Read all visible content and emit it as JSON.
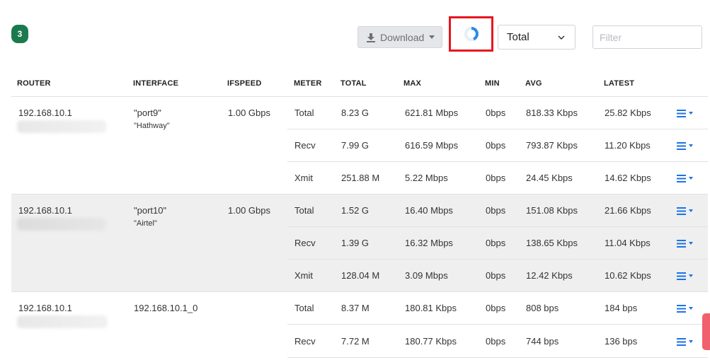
{
  "toolbar": {
    "count": "3",
    "download_label": "Download",
    "meter_select": "Total",
    "filter_placeholder": "Filter"
  },
  "colors": {
    "badge": "#1a7a4e",
    "highlight": "#e8141c",
    "accent": "#1a73e8"
  },
  "headers": [
    "ROUTER",
    "INTERFACE",
    "IFSPEED",
    "METER",
    "TOTAL",
    "MAX",
    "MIN",
    "AVG",
    "LATEST"
  ],
  "groups": [
    {
      "router": "192.168.10.1",
      "interface": "\"port9\"",
      "description": "\"Hathway\"",
      "ifspeed": "1.00 Gbps",
      "rows": [
        {
          "meter": "Total",
          "total": "8.23 G",
          "max": "621.81 Mbps",
          "min": "0bps",
          "avg": "818.33 Kbps",
          "latest": "25.82 Kbps"
        },
        {
          "meter": "Recv",
          "total": "7.99 G",
          "max": "616.59 Mbps",
          "min": "0bps",
          "avg": "793.87 Kbps",
          "latest": "11.20 Kbps"
        },
        {
          "meter": "Xmit",
          "total": "251.88 M",
          "max": "5.22 Mbps",
          "min": "0bps",
          "avg": "24.45 Kbps",
          "latest": "14.62 Kbps"
        }
      ]
    },
    {
      "router": "192.168.10.1",
      "interface": "\"port10\"",
      "description": "\"Airtel\"",
      "ifspeed": "1.00 Gbps",
      "rows": [
        {
          "meter": "Total",
          "total": "1.52 G",
          "max": "16.40 Mbps",
          "min": "0bps",
          "avg": "151.08 Kbps",
          "latest": "21.66 Kbps"
        },
        {
          "meter": "Recv",
          "total": "1.39 G",
          "max": "16.32 Mbps",
          "min": "0bps",
          "avg": "138.65 Kbps",
          "latest": "11.04 Kbps"
        },
        {
          "meter": "Xmit",
          "total": "128.04 M",
          "max": "3.09 Mbps",
          "min": "0bps",
          "avg": "12.42 Kbps",
          "latest": "10.62 Kbps"
        }
      ]
    },
    {
      "router": "192.168.10.1",
      "interface": "192.168.10.1_0",
      "description": "",
      "ifspeed": "",
      "rows": [
        {
          "meter": "Total",
          "total": "8.37 M",
          "max": "180.81 Kbps",
          "min": "0bps",
          "avg": "808 bps",
          "latest": "184 bps"
        },
        {
          "meter": "Recv",
          "total": "7.72 M",
          "max": "180.77 Kbps",
          "min": "0bps",
          "avg": "744 bps",
          "latest": "136 bps"
        }
      ]
    }
  ]
}
